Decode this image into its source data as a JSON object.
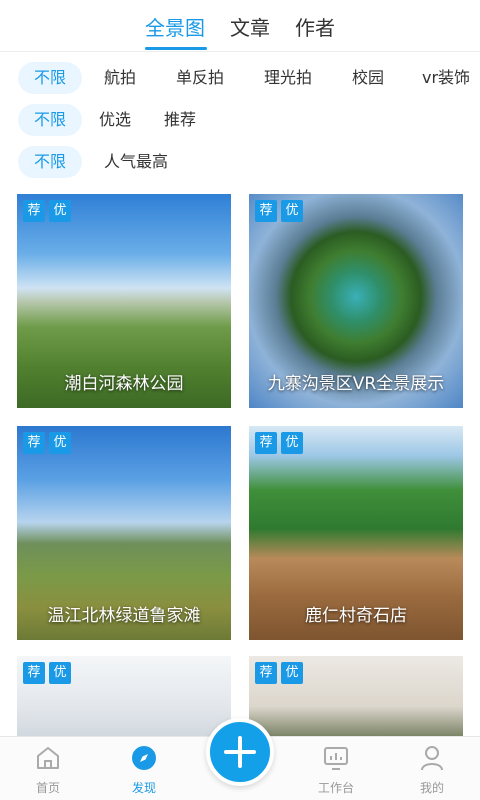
{
  "top_tabs": [
    {
      "label": "全景图",
      "active": true
    },
    {
      "label": "文章",
      "active": false
    },
    {
      "label": "作者",
      "active": false
    }
  ],
  "filters": {
    "category": [
      "不限",
      "航拍",
      "单反拍",
      "理光拍",
      "校园",
      "vr装饰"
    ],
    "quality": [
      "不限",
      "优选",
      "推荐"
    ],
    "sort": [
      "不限",
      "人气最高"
    ]
  },
  "badges": {
    "recommend": "荐",
    "excellent": "优"
  },
  "cards": [
    {
      "title": "潮白河森林公园"
    },
    {
      "title": "九寨沟景区VR全景展示"
    },
    {
      "title": "温江北林绿道鲁家滩"
    },
    {
      "title": "鹿仁村奇石店"
    },
    {
      "title": ""
    },
    {
      "title": ""
    }
  ],
  "nav": {
    "home": "首页",
    "discover": "发现",
    "workbench": "工作台",
    "mine": "我的"
  },
  "colors": {
    "accent": "#1a9ae6",
    "inactive": "#999999"
  }
}
